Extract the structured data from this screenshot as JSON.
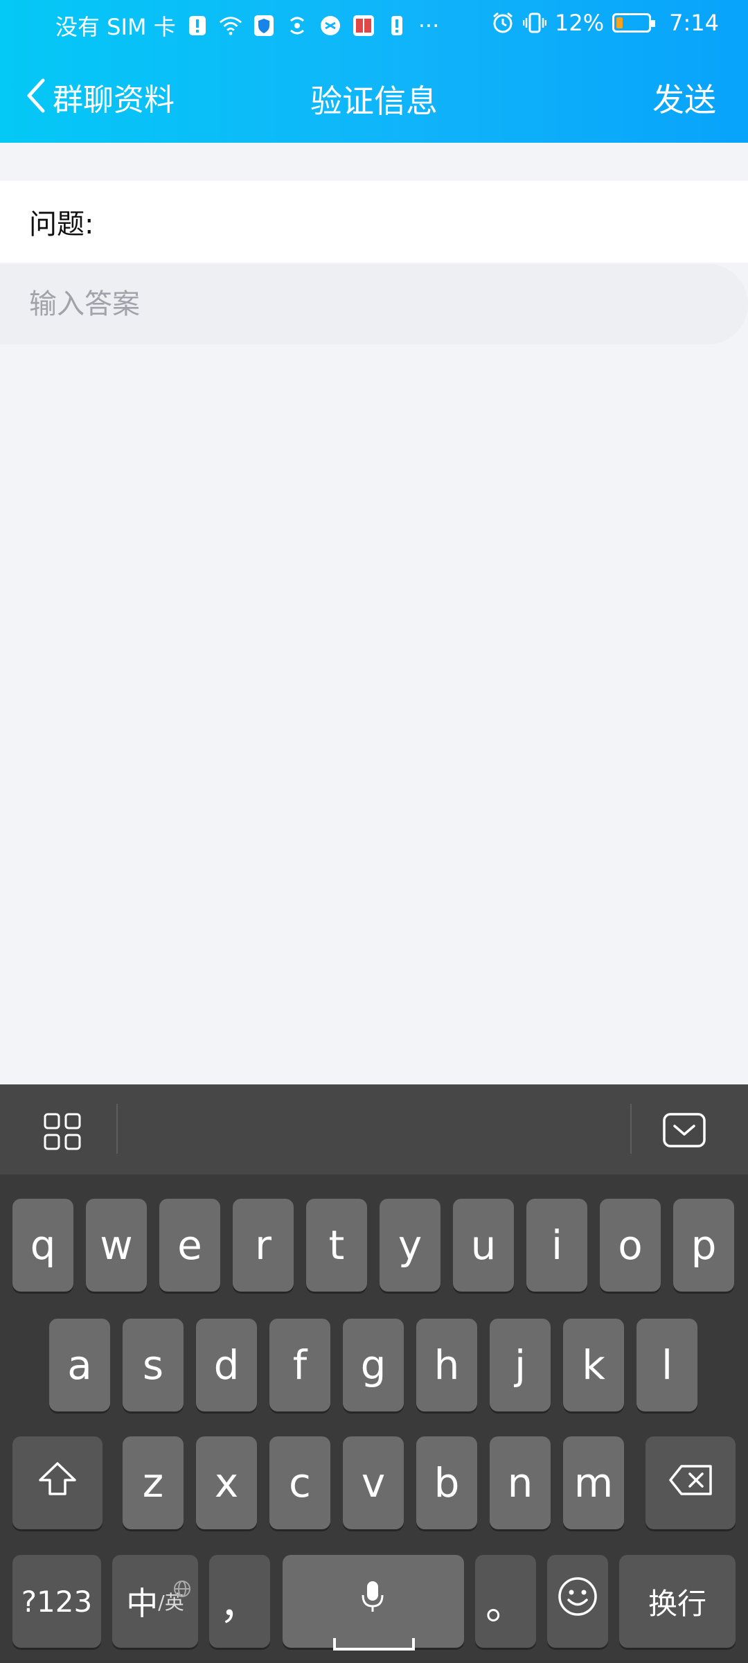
{
  "status_bar": {
    "carrier": "没有 SIM 卡",
    "more": "···",
    "battery_percent": "12%",
    "time": "7:14",
    "battery_level": 0.12,
    "icons": [
      "notification-icon",
      "wifi-icon",
      "shield-icon",
      "hotspot-icon",
      "app-icon",
      "book-icon",
      "alert-icon",
      "alarm-icon",
      "vibrate-icon",
      "battery-icon"
    ]
  },
  "nav": {
    "back_label": "群聊资料",
    "title": "验证信息",
    "send_label": "发送"
  },
  "form": {
    "question_label": "问题:",
    "answer_value": "",
    "answer_placeholder": "输入答案"
  },
  "keyboard": {
    "row1": [
      "q",
      "w",
      "e",
      "r",
      "t",
      "y",
      "u",
      "i",
      "o",
      "p"
    ],
    "row2": [
      "a",
      "s",
      "d",
      "f",
      "g",
      "h",
      "j",
      "k",
      "l"
    ],
    "row3": [
      "z",
      "x",
      "c",
      "v",
      "b",
      "n",
      "m"
    ],
    "sym_label": "?123",
    "lang_main": "中",
    "lang_sub": "/英",
    "comma": "，",
    "period": "。",
    "enter_label": "换行"
  },
  "colors": {
    "header_start": "#04c8f6",
    "header_end": "#08a3fb",
    "keyboard_bg": "#3a3a3a",
    "key_bg": "#6c6c6c"
  }
}
